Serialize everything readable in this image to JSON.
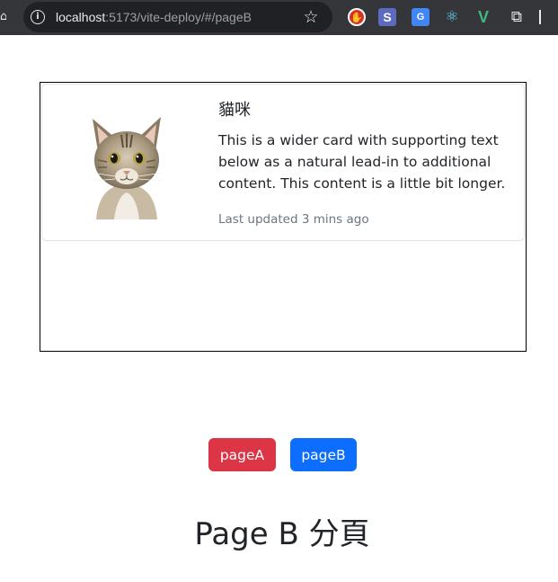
{
  "browser": {
    "url_host": "localhost",
    "url_path": ":5173/vite-deploy/#/pageB",
    "extensions": [
      "stop-extension-icon",
      "s-extension-icon",
      "translate-extension-icon",
      "react-devtools-icon",
      "vue-devtools-icon",
      "extensions-puzzle-icon"
    ]
  },
  "card": {
    "image": "cat-photo",
    "title": "貓咪",
    "text": "This is a wider card with supporting text below as a natural lead-in to additional content. This content is a little bit longer.",
    "muted": "Last updated 3 mins ago"
  },
  "nav": {
    "page_a": "pageA",
    "page_b": "pageB"
  },
  "heading": "Page B 分頁",
  "colors": {
    "danger": "#dc3545",
    "primary": "#0d6efd",
    "chrome_bg": "#35363a",
    "omnibox_bg": "#202124"
  }
}
